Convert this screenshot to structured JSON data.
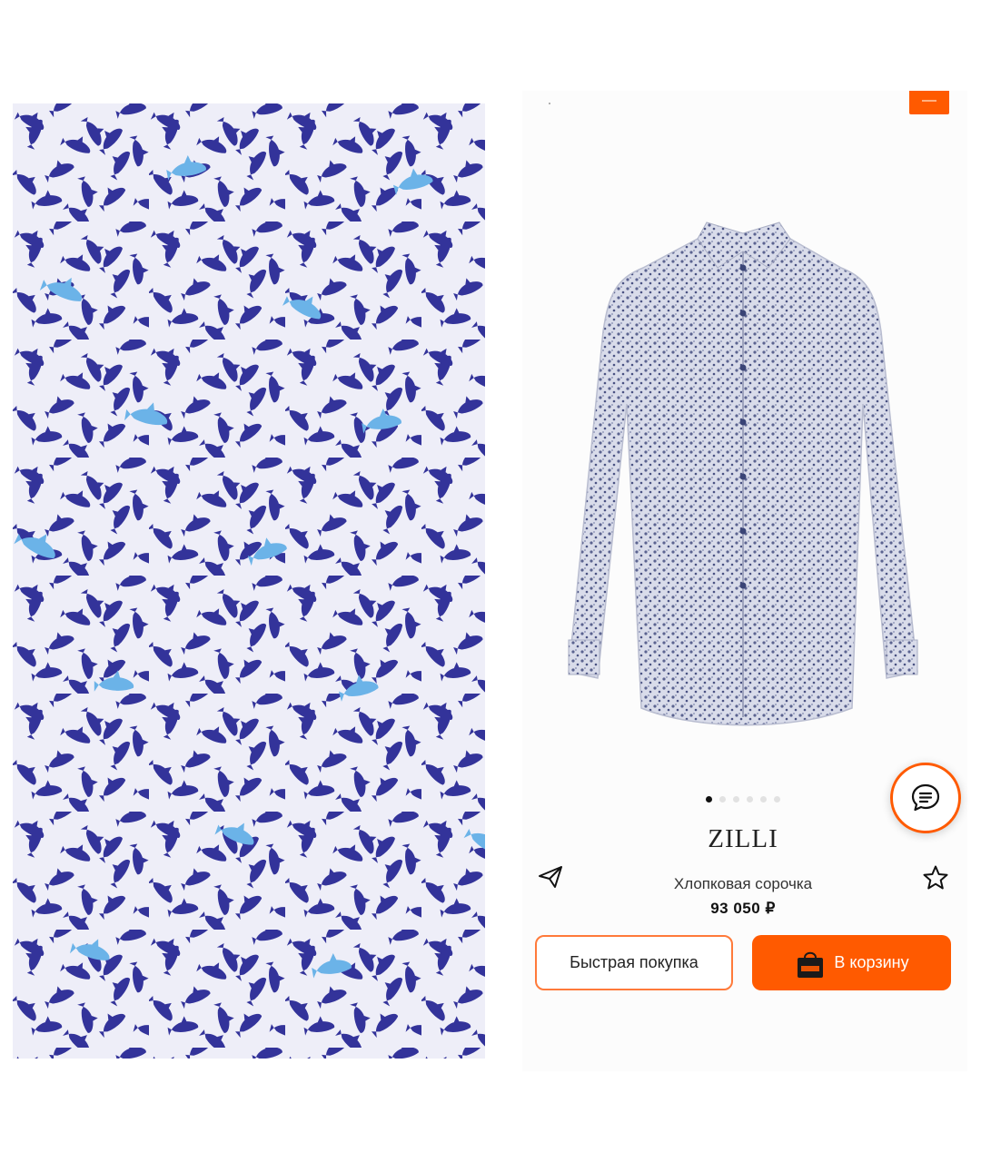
{
  "product": {
    "brand": "ZILLI",
    "name": "Хлопковая сорочка",
    "price": "93 050 ₽"
  },
  "actions": {
    "quick_buy_label": "Быстрая покупка",
    "add_to_cart_label": "В корзину"
  },
  "gallery": {
    "total_images": 6,
    "active_index": 0
  },
  "icons": {
    "share": "paper-plane-icon",
    "favorite": "star-outline-icon",
    "chat": "chat-bubble-icon",
    "cart": "shopping-bag-icon"
  },
  "colors": {
    "accent": "#ff5a00",
    "fish_dark": "#33339a",
    "fish_light": "#6bb3e8",
    "fabric": "#eeeef8"
  }
}
